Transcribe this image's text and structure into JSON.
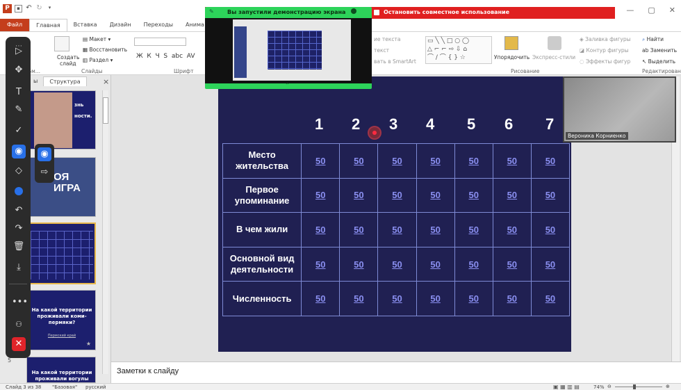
{
  "titlebar": {
    "share_label": "Остановить совместное использование",
    "minimize": "—",
    "restore": "▢",
    "close": "✕"
  },
  "share_preview": {
    "title": "Вы запустили демонстрацию экрана"
  },
  "tabs": [
    "Файл",
    "Главная",
    "Вставка",
    "Дизайн",
    "Переходы",
    "Анима"
  ],
  "ribbon": {
    "slides_group": {
      "layout": "Макет",
      "reset": "Восстановить",
      "new_slide_l1": "Создать",
      "new_slide_l2": "слайд",
      "section": "Раздел",
      "label": "Слайды"
    },
    "font_group": {
      "label": "Шрифт"
    },
    "text_group": {
      "direction": "ие текста",
      "align": "текст",
      "smartart": "вать в SmartArt"
    },
    "drawing_group": {
      "arrange": "Упорядочить",
      "quick_styles": "Экспресс-стили",
      "fill": "Заливка фигуры",
      "outline": "Контур фигуры",
      "effects": "Эффекты фигур",
      "label": "Рисование"
    },
    "editing_group": {
      "find": "Найти",
      "replace": "Заменить",
      "select": "Выделить",
      "label": "Редактирование"
    },
    "clipboard_label": "Бм..."
  },
  "left_panel": {
    "tabs": [
      "ы",
      "Структура"
    ],
    "close": "×",
    "thumb1_text": "знь\nности.",
    "thumb2_text": "ОЯ\nИГРА",
    "thumb4_title": "На какой территории проживали коми-пермяки?",
    "thumb4_sub": "Пермский край",
    "thumb5_title": "На какой территории проживали вогулы",
    "slide_num_5": "5",
    "numbers": [
      "2",
      "3",
      "4"
    ]
  },
  "slide": {
    "columns": [
      "1",
      "2",
      "3",
      "4",
      "5",
      "6",
      "7"
    ],
    "rows": [
      {
        "category": "Место жительства",
        "values": [
          "50",
          "50",
          "50",
          "50",
          "50",
          "50",
          "50"
        ]
      },
      {
        "category": "Первое упоминание",
        "values": [
          "50",
          "50",
          "50",
          "50",
          "50",
          "50",
          "50"
        ]
      },
      {
        "category": "В чем жили",
        "values": [
          "50",
          "50",
          "50",
          "50",
          "50",
          "50",
          "50"
        ]
      },
      {
        "category": "Основной вид деятельности",
        "values": [
          "50",
          "50",
          "50",
          "50",
          "50",
          "50",
          "50"
        ]
      },
      {
        "category": "Численность",
        "values": [
          "50",
          "50",
          "50",
          "50",
          "50",
          "50",
          "50"
        ]
      }
    ]
  },
  "webcam": {
    "name": "Вероника Корниенко"
  },
  "notes": {
    "placeholder": "Заметки к слайду"
  },
  "statusbar": {
    "slide_info": "Слайд 3 из 38",
    "theme": "\"Базовая\"",
    "language": "русский",
    "zoom": "74%"
  },
  "colors": {
    "accent": "#c43e1c",
    "share_red": "#e02020",
    "share_green": "#2dd35a",
    "slide_bg": "#202052",
    "cell_value": "#8a8ff0",
    "tool_selected": "#2870e8"
  }
}
